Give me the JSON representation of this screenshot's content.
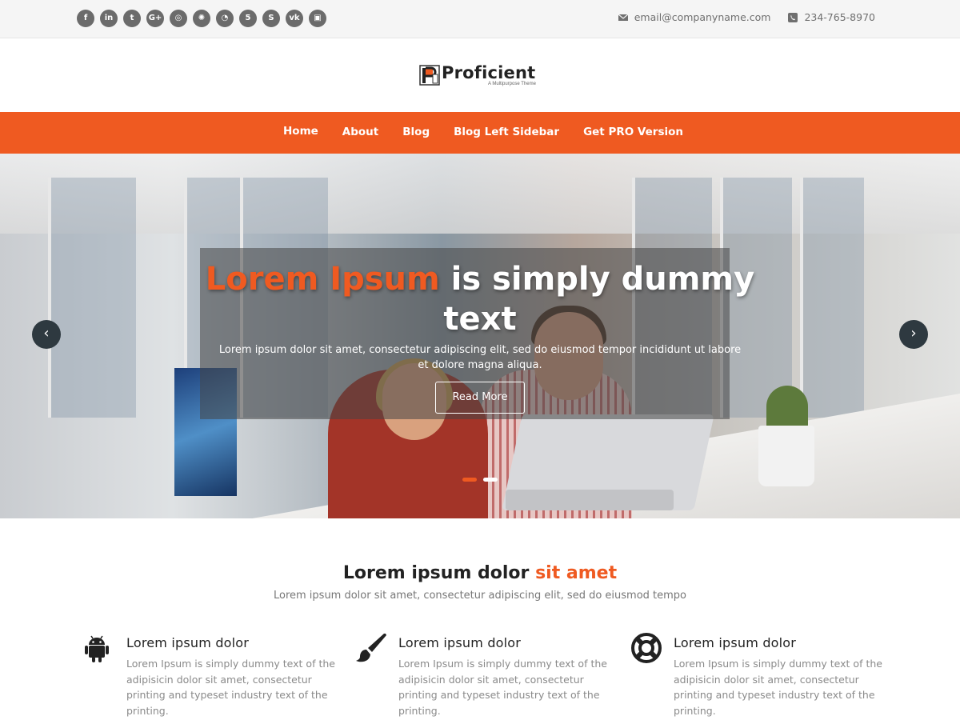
{
  "topbar": {
    "social_icons": [
      "facebook-icon",
      "linkedin-icon",
      "twitter-icon",
      "google-plus-icon",
      "instagram-icon",
      "dribbble-icon",
      "github-icon",
      "html5-icon",
      "skype-icon",
      "vk-icon",
      "fourth-icon"
    ],
    "social_glyphs": [
      "f",
      "in",
      "t",
      "G+",
      "◎",
      "✺",
      "◔",
      "5",
      "S",
      "vk",
      "▣"
    ],
    "email": "email@companyname.com",
    "phone": "234-765-8970"
  },
  "logo": {
    "name": "Proficient",
    "tagline": "A Multipurpose Theme"
  },
  "nav": {
    "items": [
      "Home",
      "About",
      "Blog",
      "Blog Left Sidebar",
      "Get PRO Version"
    ]
  },
  "hero": {
    "title_highlight": "Lorem Ipsum",
    "title_rest": " is simply dummy text",
    "subtitle": "Lorem ipsum dolor sit amet, consectetur adipiscing elit, sed do eiusmod tempor incididunt ut labore et dolore magna aliqua.",
    "button": "Read More",
    "prev_arrow": "‹",
    "next_arrow": "›"
  },
  "section": {
    "title_plain": "Lorem ipsum dolor ",
    "title_highlight": "sit amet",
    "subtitle": "Lorem ipsum dolor sit amet, consectetur adipiscing elit, sed do eiusmod tempo"
  },
  "features": [
    {
      "icon": "android-icon",
      "title": "Lorem ipsum dolor",
      "text": "Lorem Ipsum is simply dummy text of the adipisicin dolor sit amet, consectetur printing and typeset industry text of the printing."
    },
    {
      "icon": "paintbrush-icon",
      "title": "Lorem ipsum dolor",
      "text": "Lorem Ipsum is simply dummy text of the adipisicin dolor sit amet, consectetur printing and typeset industry text of the printing."
    },
    {
      "icon": "lifebuoy-icon",
      "title": "Lorem ipsum dolor",
      "text": "Lorem Ipsum is simply dummy text of the adipisicin dolor sit amet, consectetur printing and typeset industry text of the printing."
    }
  ],
  "colors": {
    "accent": "#ef5a21",
    "dark": "#222222",
    "muted": "#8a8a8a"
  }
}
